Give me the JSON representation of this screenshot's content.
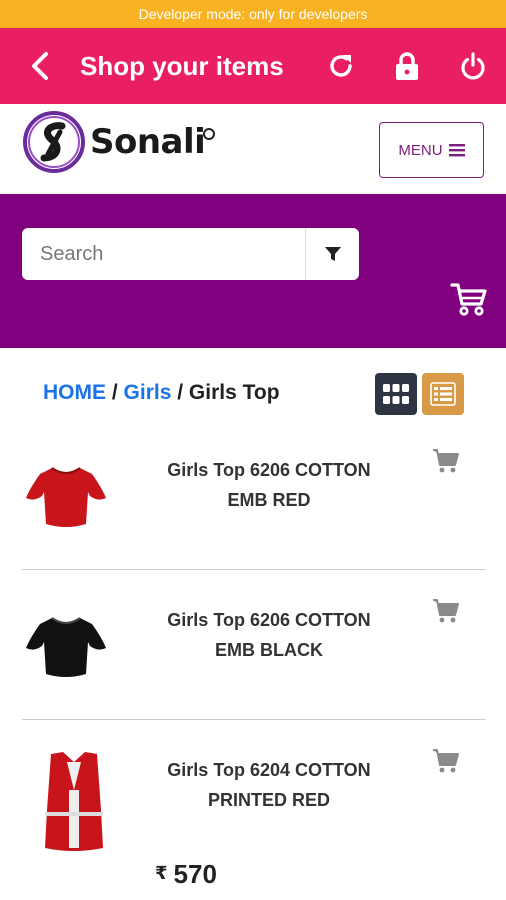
{
  "dev_banner": "Developer mode: only for developers",
  "appbar": {
    "title": "Shop your items",
    "icons": [
      "back-arrow-icon",
      "refresh-icon",
      "lock-icon",
      "power-icon"
    ]
  },
  "header": {
    "logo_text": "Sonali",
    "menu_label": "MENU"
  },
  "search": {
    "placeholder": "Search"
  },
  "breadcrumb": {
    "home": "HOME",
    "sep1": "/",
    "category": "Girls",
    "sep2": "/",
    "current": "Girls Top"
  },
  "products": [
    {
      "line1": "Girls Top 6206 COTTON",
      "line2": "EMB RED"
    },
    {
      "line1": "Girls Top 6206 COTTON",
      "line2": "EMB BLACK"
    },
    {
      "line1": "Girls Top 6204 COTTON",
      "line2": "PRINTED RED",
      "price_symbol": "₹",
      "price": "570"
    }
  ],
  "colors": {
    "dev_banner": "#f9b322",
    "appbar": "#ea1f63",
    "search_band": "#800080",
    "link": "#1a73e8",
    "grid_view": "#2f3442",
    "list_view": "#d99a47"
  }
}
